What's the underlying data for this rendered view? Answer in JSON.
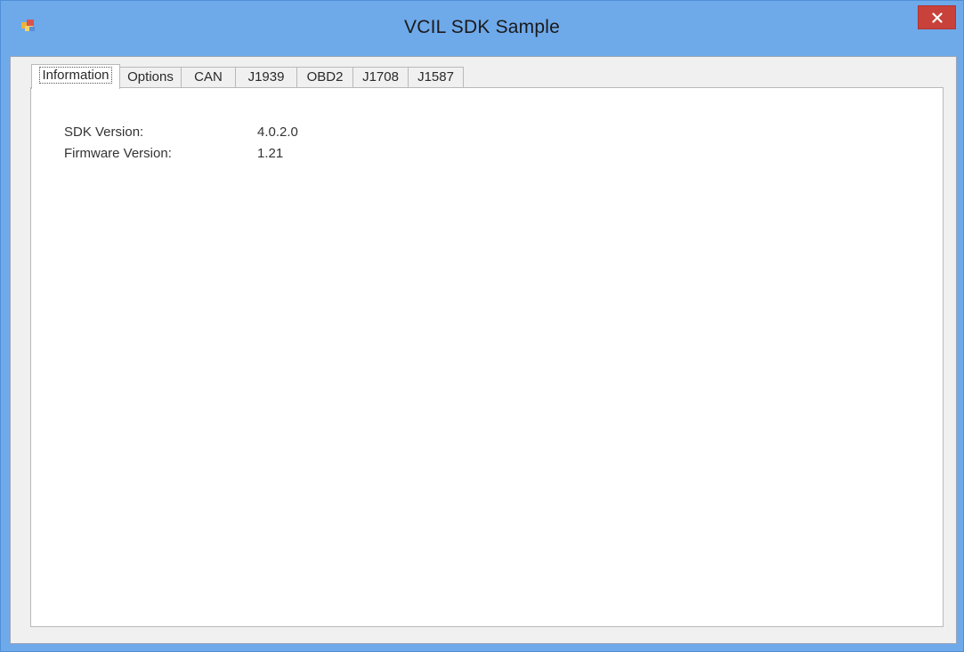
{
  "window": {
    "title": "VCIL SDK Sample",
    "icon": "app-icon",
    "close_icon": "close-icon"
  },
  "tabs": [
    {
      "label": "Information",
      "selected": true
    },
    {
      "label": "Options",
      "selected": false
    },
    {
      "label": "CAN",
      "selected": false
    },
    {
      "label": "J1939",
      "selected": false
    },
    {
      "label": "OBD2",
      "selected": false
    },
    {
      "label": "J1708",
      "selected": false
    },
    {
      "label": "J1587",
      "selected": false
    }
  ],
  "information": {
    "sdk_version_label": "SDK Version:",
    "sdk_version_value": "4.0.2.0",
    "firmware_version_label": "Firmware Version:",
    "firmware_version_value": "1.21"
  },
  "colors": {
    "title_bar": "#6ea9ea",
    "close_button": "#c8413a",
    "client_bg": "#f0f0f0",
    "panel_bg": "#ffffff"
  }
}
